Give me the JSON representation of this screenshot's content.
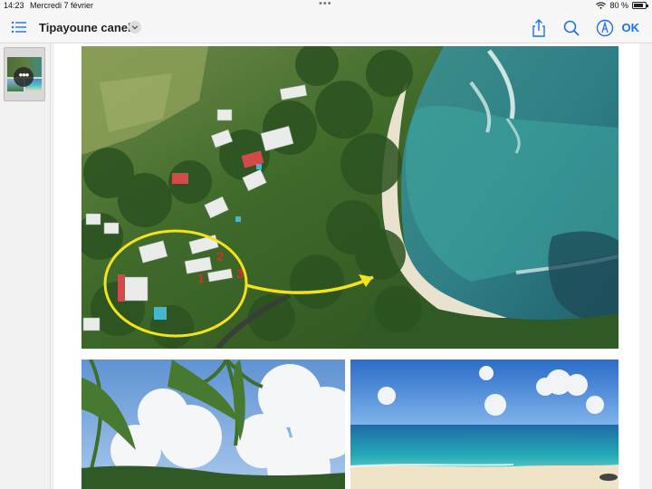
{
  "status_bar": {
    "time": "14:23",
    "date": "Mercredi 7 février",
    "battery": "80 %"
  },
  "toolbar": {
    "title": "Tipayoune canelle",
    "ok_label": "OK",
    "icons": [
      "list-icon",
      "chevron-down-icon",
      "share-icon",
      "search-icon",
      "markup-icon"
    ]
  },
  "document": {
    "annotations": {
      "label_1": "1",
      "label_2": "2",
      "label_3": "3"
    }
  }
}
